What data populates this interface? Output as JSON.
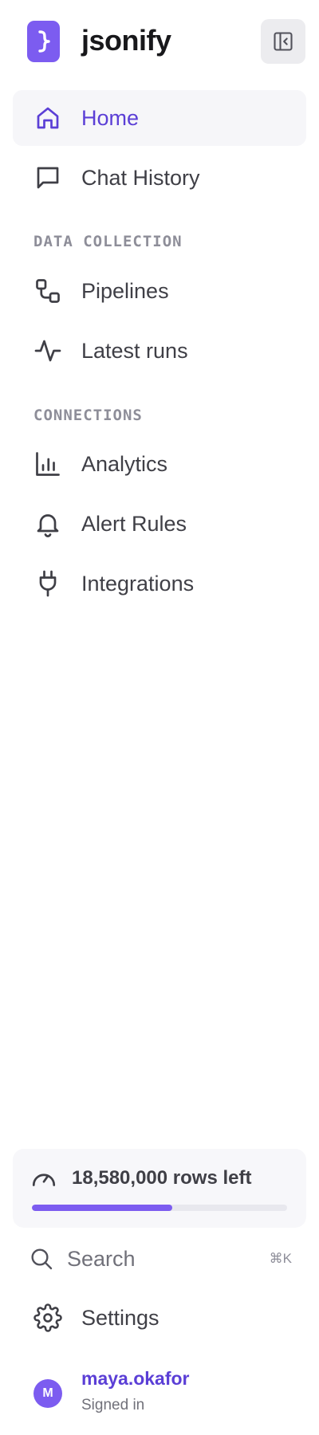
{
  "brand": {
    "name": "jsonify",
    "logo_glyph": "}",
    "accent_color": "#7c5cf0",
    "active_text_color": "#5b3fd6"
  },
  "header": {
    "collapse_icon": "sidebar-collapse-icon"
  },
  "nav": {
    "primary": [
      {
        "label": "Home",
        "icon": "home-icon",
        "active": true
      },
      {
        "label": "Chat History",
        "icon": "chat-bubble-icon",
        "active": false
      }
    ],
    "sections": [
      {
        "title": "DATA COLLECTION",
        "items": [
          {
            "label": "Pipelines",
            "icon": "pipeline-icon"
          },
          {
            "label": "Latest runs",
            "icon": "activity-icon"
          }
        ]
      },
      {
        "title": "CONNECTIONS",
        "items": [
          {
            "label": "Analytics",
            "icon": "bar-chart-icon"
          },
          {
            "label": "Alert Rules",
            "icon": "bell-icon"
          },
          {
            "label": "Integrations",
            "icon": "plug-icon"
          }
        ]
      }
    ]
  },
  "usage": {
    "text": "18,580,000 rows left",
    "icon": "gauge-icon",
    "progress_fraction": 0.55
  },
  "search": {
    "label": "Search",
    "shortcut": "⌘K",
    "icon": "search-icon"
  },
  "settings": {
    "label": "Settings",
    "icon": "gear-icon"
  },
  "user": {
    "initial": "M",
    "name": "maya.okafor",
    "status": "Signed in"
  }
}
